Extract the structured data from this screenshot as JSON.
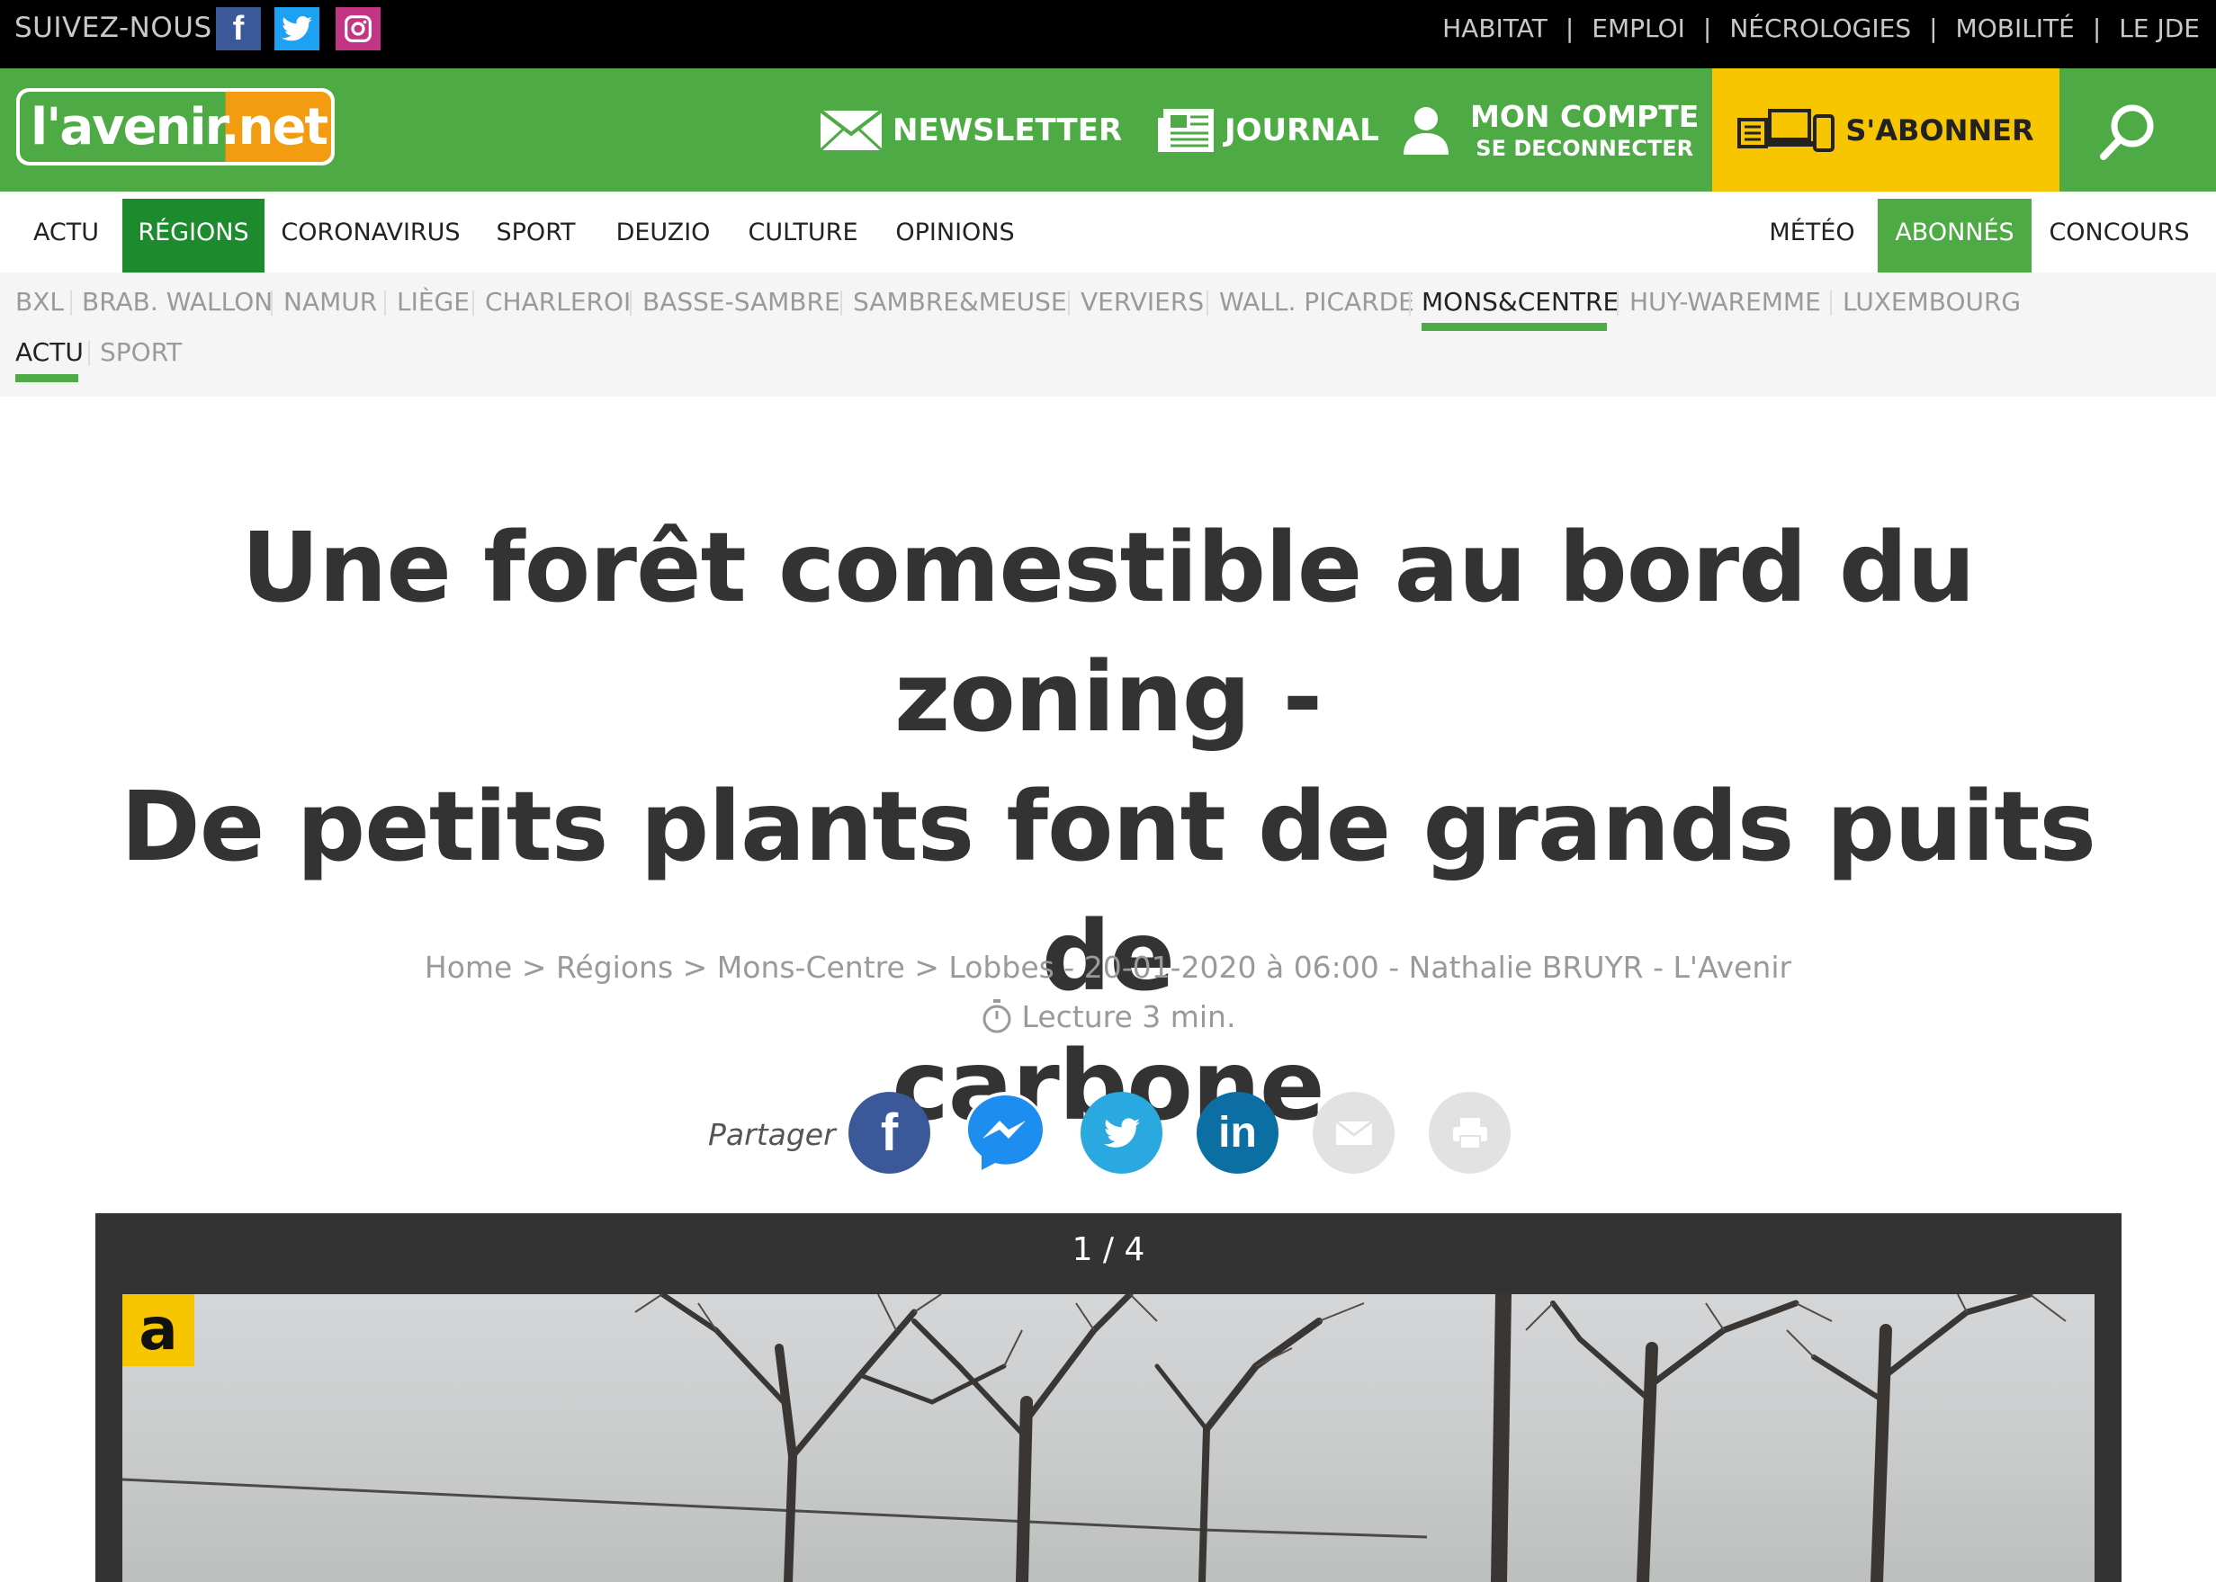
{
  "topbar": {
    "follow_label": "SUIVEZ-NOUS",
    "social": [
      "facebook-icon",
      "twitter-icon",
      "instagram-icon"
    ],
    "links": [
      "HABITAT",
      "EMPLOI",
      "NÉCROLOGIES",
      "MOBILITÉ",
      "LE JDE"
    ]
  },
  "header": {
    "logo_text": "l'avenir.net",
    "newsletter": "NEWSLETTER",
    "journal": "JOURNAL",
    "account": "MON COMPTE",
    "logout": "SE DECONNECTER",
    "subscribe": "S'ABONNER"
  },
  "mainnav": {
    "items": [
      "ACTU",
      "RÉGIONS",
      "CORONAVIRUS",
      "SPORT",
      "DEUZIO",
      "CULTURE",
      "OPINIONS",
      "MÉTÉO",
      "ABONNÉS",
      "CONCOURS"
    ],
    "active": "RÉGIONS"
  },
  "regions": {
    "items": [
      "BXL",
      "BRAB. WALLON",
      "NAMUR",
      "LIÈGE",
      "CHARLEROI",
      "BASSE-SAMBRE",
      "SAMBRE&MEUSE",
      "VERVIERS",
      "WALL. PICARDE",
      "MONS&CENTRE",
      "HUY-WAREMME",
      "LUXEMBOURG"
    ],
    "active": "MONS&CENTRE",
    "sub_items": [
      "ACTU",
      "SPORT"
    ],
    "sub_active": "ACTU"
  },
  "article": {
    "title_line1": "Une forêt comestible au bord du zoning -",
    "title_line2": "De petits plants font de grands puits de",
    "title_line3": "carbone",
    "meta": "Home > Régions > Mons-Centre > Lobbes - 20-01-2020 à 06:00 - Nathalie BRUYR - L'Avenir",
    "reading_time": "Lecture 3 min.",
    "share_label": "Partager"
  },
  "gallery": {
    "counter": "1 / 4",
    "badge": "a"
  },
  "colors": {
    "brand_green": "#4daa44",
    "accent_yellow": "#f7c600",
    "regions_active": "#1e8a2e"
  }
}
